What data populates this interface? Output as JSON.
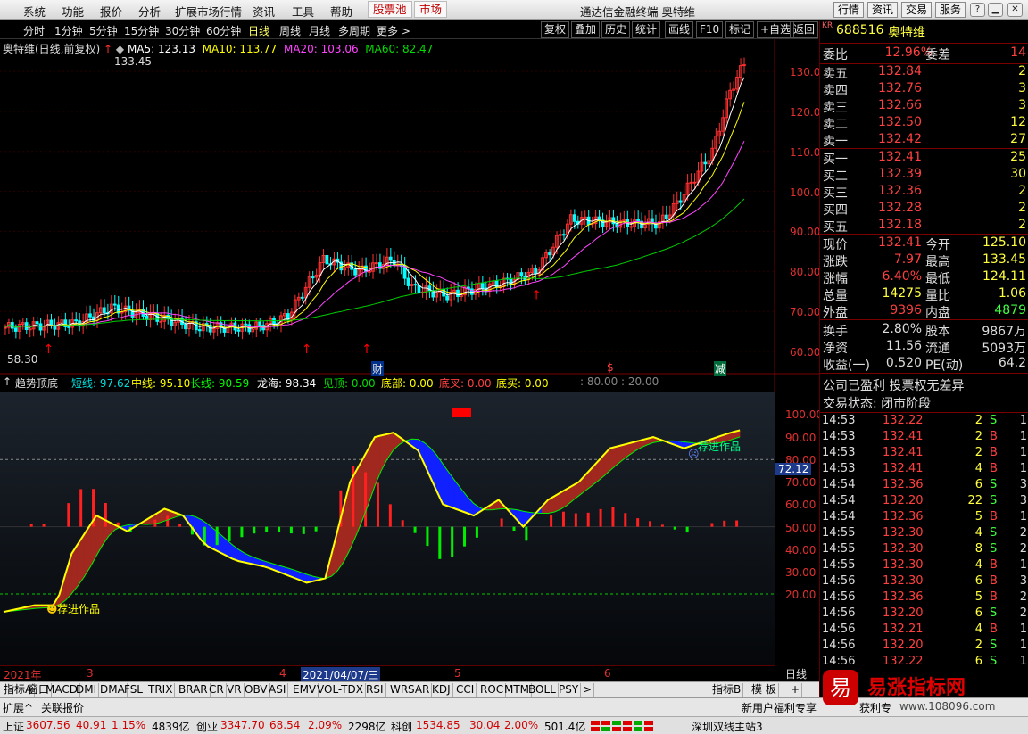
{
  "menubar": {
    "items": [
      "系统",
      "功能",
      "报价",
      "分析",
      "扩展市场行情",
      "资讯",
      "工具",
      "帮助"
    ],
    "special": [
      "股票池",
      "市场"
    ],
    "title": "通达信金融终端  奥特维",
    "buttons": [
      "行情",
      "资讯",
      "交易",
      "服务"
    ]
  },
  "toolbar": {
    "left": [
      "分时",
      "1分钟",
      "5分钟",
      "15分钟",
      "30分钟",
      "60分钟",
      "日线",
      "周线",
      "月线",
      "多周期",
      "更多 >"
    ],
    "active": "日线",
    "right": [
      "复权",
      "叠加",
      "历史",
      "统计",
      "画线",
      "F10",
      "标记",
      "+自选",
      "返回"
    ]
  },
  "kline": {
    "title": "奥特维(日线,前复权)",
    "ma5": "MA5: 123.13",
    "ma10": "MA10: 113.77",
    "ma20": "MA20: 103.06",
    "ma60": "MA60: 82.47",
    "high_label": "133.45",
    "low_label": "58.30",
    "yticks": [
      "130.00",
      "120.00",
      "110.00",
      "100.00",
      "90.00",
      "80.00",
      "70.00",
      "60.00"
    ],
    "markers": [
      "财",
      "$",
      "减"
    ],
    "colors": {
      "ma5": "#ffffff",
      "ma10": "#ffff00",
      "ma20": "#ff00ff",
      "ma60": "#00cc00",
      "up": "#ff3030",
      "down": "#00ffff"
    }
  },
  "indicator": {
    "name": "趋势顶底",
    "short": "短线: 97.62",
    "mid": "中线: 95.10",
    "long": "长线: 90.59",
    "dragon": "龙海: 98.34",
    "seetop": "见顶: 0.00",
    "bottom": "底部: 0.00",
    "bcross": "底叉: 0.00",
    "bbuy": "底买: 0.00",
    "levels": ": 80.00 : 20.00",
    "yticks": [
      "100.00",
      "90.00",
      "80.00",
      "70.00",
      "60.00",
      "50.00",
      "40.00",
      "30.00",
      "20.00"
    ],
    "current": "72.12",
    "tag1": "荐进作品",
    "tag2": "荐进作品"
  },
  "dates": {
    "year": "2021年",
    "m3": "3",
    "m4": "4",
    "sel": "2021/04/07/三",
    "m5": "5",
    "m6": "6",
    "period": "日线"
  },
  "tabs": {
    "left": [
      "指标A",
      "窗口",
      "MACD",
      "DMI",
      "DMA",
      "FSL",
      "TRIX",
      "BRAR",
      "CR",
      "VR",
      "OBV",
      "ASI",
      "EMV",
      "VOL-TDX",
      "RSI",
      "WR",
      "SAR",
      "KDJ",
      "CCI",
      "ROC",
      "MTM",
      "BOLL",
      "PSY",
      ">"
    ],
    "right": [
      "指标B",
      "模 板",
      "+"
    ]
  },
  "quote": {
    "code": "688516",
    "name": "奥特维",
    "weibi_label": "委比",
    "weibi": "12.96%",
    "weicha_label": "委差",
    "weicha": "14",
    "sells": [
      {
        "k": "卖五",
        "p": "132.84",
        "v": "2"
      },
      {
        "k": "卖四",
        "p": "132.76",
        "v": "3"
      },
      {
        "k": "卖三",
        "p": "132.66",
        "v": "3"
      },
      {
        "k": "卖二",
        "p": "132.50",
        "v": "12"
      },
      {
        "k": "卖一",
        "p": "132.42",
        "v": "27"
      }
    ],
    "buys": [
      {
        "k": "买一",
        "p": "132.41",
        "v": "25"
      },
      {
        "k": "买二",
        "p": "132.39",
        "v": "30"
      },
      {
        "k": "买三",
        "p": "132.36",
        "v": "2"
      },
      {
        "k": "买四",
        "p": "132.28",
        "v": "2"
      },
      {
        "k": "买五",
        "p": "132.18",
        "v": "2"
      }
    ],
    "stats": [
      {
        "k": "现价",
        "v": "132.41",
        "k2": "今开",
        "v2": "125.10"
      },
      {
        "k": "涨跌",
        "v": "7.97",
        "k2": "最高",
        "v2": "133.45"
      },
      {
        "k": "涨幅",
        "v": "6.40%",
        "k2": "最低",
        "v2": "124.11"
      },
      {
        "k": "总量",
        "v": "14275",
        "k2": "量比",
        "v2": "1.06"
      },
      {
        "k": "外盘",
        "v": "9396",
        "k2": "内盘",
        "v2": "4879"
      }
    ],
    "stats2": [
      {
        "k": "换手",
        "v": "2.80%",
        "k2": "股本",
        "v2": "9867万"
      },
      {
        "k": "净资",
        "v": "11.56",
        "k2": "流通",
        "v2": "5093万"
      },
      {
        "k": "收益(一)",
        "v": "0.520",
        "k2": "PE(动)",
        "v2": "64.2"
      }
    ],
    "notice": "公司已盈利 投票权无差异",
    "status": "交易状态: 闭市阶段",
    "ticks": [
      [
        "14:53",
        "132.22",
        "2",
        "S",
        "1"
      ],
      [
        "14:53",
        "132.41",
        "2",
        "B",
        "1"
      ],
      [
        "14:53",
        "132.41",
        "2",
        "B",
        "1"
      ],
      [
        "14:53",
        "132.41",
        "4",
        "B",
        "1"
      ],
      [
        "14:54",
        "132.36",
        "6",
        "S",
        "3"
      ],
      [
        "14:54",
        "132.20",
        "22",
        "S",
        "3"
      ],
      [
        "14:54",
        "132.36",
        "5",
        "B",
        "1"
      ],
      [
        "14:55",
        "132.30",
        "4",
        "S",
        "2"
      ],
      [
        "14:55",
        "132.30",
        "8",
        "S",
        "2"
      ],
      [
        "14:55",
        "132.30",
        "4",
        "B",
        "1"
      ],
      [
        "14:56",
        "132.30",
        "6",
        "B",
        "3"
      ],
      [
        "14:56",
        "132.36",
        "5",
        "B",
        "2"
      ],
      [
        "14:56",
        "132.20",
        "6",
        "S",
        "2"
      ],
      [
        "14:56",
        "132.21",
        "4",
        "B",
        "1"
      ],
      [
        "14:56",
        "132.20",
        "2",
        "S",
        "1"
      ],
      [
        "14:56",
        "132.22",
        "6",
        "S",
        "1"
      ]
    ]
  },
  "bottom": {
    "expand": "扩展^",
    "related": "关联报价",
    "news": "新用户福利专享",
    "news2": "获利专"
  },
  "status": {
    "sh_label": "上证",
    "sh": "3607.56",
    "sh_chg": "40.91",
    "sh_pct": "1.15%",
    "sh_amt": "4839亿",
    "cy_label": "创业",
    "cy": "3347.70",
    "cy_chg": "68.54",
    "cy_pct": "2.09%",
    "cy_amt": "2298亿",
    "kc_label": "科创",
    "kc": "1534.85",
    "kc_chg": "30.04",
    "kc_pct": "2.00%",
    "kc_amt": "501.4亿",
    "server": "深圳双线主站3"
  },
  "watermark": {
    "name": "易涨指标网",
    "url": "www.108096.com"
  }
}
